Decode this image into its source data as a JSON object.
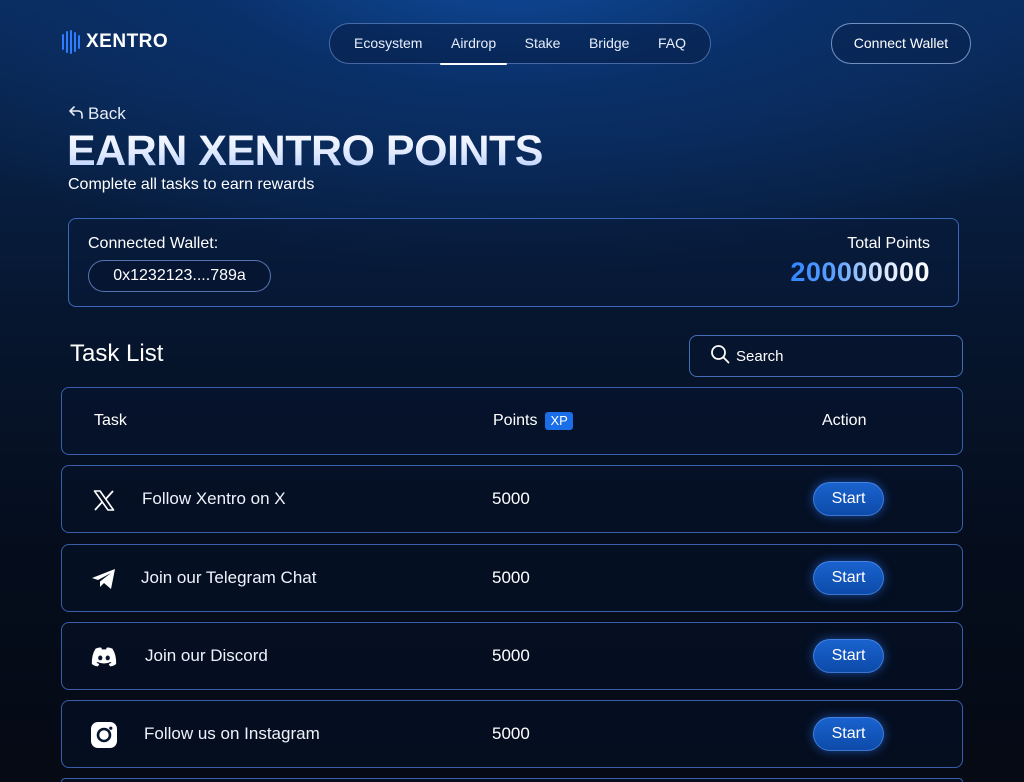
{
  "header": {
    "logo_text": "XENTRO",
    "nav": [
      {
        "label": "Ecosystem",
        "active": false
      },
      {
        "label": "Airdrop",
        "active": true
      },
      {
        "label": "Stake",
        "active": false
      },
      {
        "label": "Bridge",
        "active": false
      },
      {
        "label": "FAQ",
        "active": false
      }
    ],
    "connect_label": "Connect Wallet"
  },
  "hero": {
    "back_label": "Back",
    "title": "EARN XENTRO POINTS",
    "subtitle": "Complete all tasks to earn rewards"
  },
  "wallet": {
    "label": "Connected Wallet:",
    "address": "0x1232123....789a",
    "points_label": "Total Points",
    "points_value": "200000000"
  },
  "tasks": {
    "title": "Task List",
    "search_placeholder": "Search",
    "columns": {
      "task": "Task",
      "points": "Points",
      "xp_badge": "XP",
      "action": "Action"
    },
    "rows": [
      {
        "icon": "x-icon",
        "label": "Follow Xentro on X",
        "points": "5000",
        "action": "Start"
      },
      {
        "icon": "telegram-icon",
        "label": "Join our Telegram Chat",
        "points": "5000",
        "action": "Start"
      },
      {
        "icon": "discord-icon",
        "label": "Join our Discord",
        "points": "5000",
        "action": "Start"
      },
      {
        "icon": "instagram-icon",
        "label": "Follow us on Instagram",
        "points": "5000",
        "action": "Start"
      }
    ]
  },
  "colors": {
    "accent": "#1a6fe8",
    "border": "#4f82e6",
    "background": "#06162f"
  }
}
